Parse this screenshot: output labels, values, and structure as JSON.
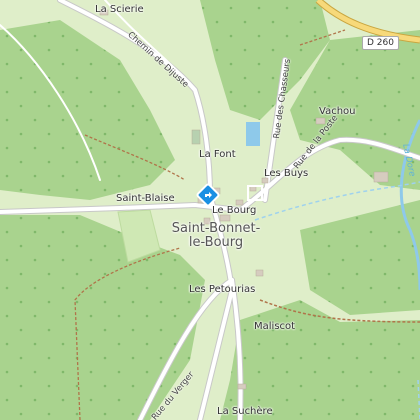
{
  "map": {
    "places": {
      "la_scierie": "La Scierie",
      "vachou": "Vachou",
      "la_font": "La Font",
      "les_buys": "Les Buys",
      "saint_blaise": "Saint-Blaise",
      "le_bourg": "Le Bourg",
      "town_line1": "Saint-Bonnet-",
      "town_line2": "le-Bourg",
      "les_petourias": "Les Petourias",
      "maliscot": "Maliscot",
      "la_suchere": "La Suchère"
    },
    "streets": {
      "chemin_de_dijuste": "Chemin de Dijuste",
      "rue_des_chasseurs": "Rue des Chasseurs",
      "rue_de_la_poste": "Rue de la Poste",
      "rue_du_verger": "Rue du Verger"
    },
    "road_shield": "D 260",
    "river": "La Dore",
    "colors": {
      "forest": "#a9d38e",
      "meadow": "#dfeec9",
      "road": "#ffffff",
      "major_road": "#f7d97a",
      "path": "#b0744a",
      "water": "#8ec9ea",
      "marker": "#1a8fe3"
    },
    "marker_icon": "direction-sign-icon"
  }
}
